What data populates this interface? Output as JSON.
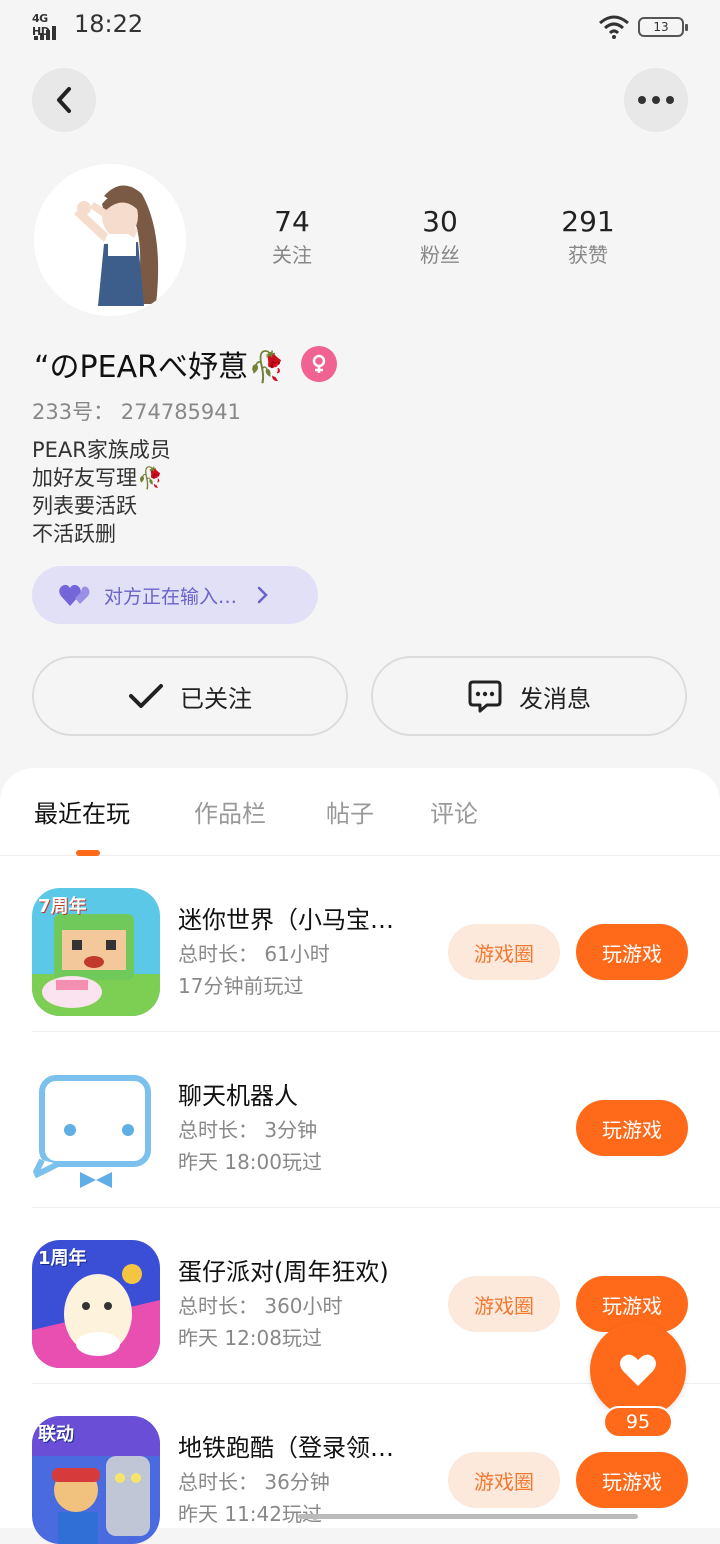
{
  "status_bar": {
    "network": "4G HD",
    "time": "18:22",
    "battery": "13"
  },
  "profile": {
    "stats": [
      {
        "value": "74",
        "label": "关注"
      },
      {
        "value": "30",
        "label": "粉丝"
      },
      {
        "value": "291",
        "label": "获赞"
      }
    ],
    "nickname": "“のPEARべ妤蒠🥀",
    "uid": "233号： 274785941",
    "bio": [
      "PEAR家族成员",
      "加好友写理🥀",
      "列表要活跃",
      "不活跃删"
    ],
    "typing_status": "对方正在输入…"
  },
  "actions": {
    "followed_label": "已关注",
    "message_label": "发消息"
  },
  "tabs": [
    {
      "label": "最近在玩",
      "active": true
    },
    {
      "label": "作品栏",
      "active": false
    },
    {
      "label": "帖子",
      "active": false
    },
    {
      "label": "评论",
      "active": false
    }
  ],
  "games": [
    {
      "name": "迷你世界（小马宝…",
      "duration": "总时长： 61小时",
      "last_played": "17分钟前玩过",
      "circle_label": "游戏圈",
      "play_label": "玩游戏",
      "icon_badge": "7周年"
    },
    {
      "name": "聊天机器人",
      "duration": "总时长： 3分钟",
      "last_played": "昨天 18:00玩过",
      "circle_label": "",
      "play_label": "玩游戏",
      "icon_badge": ""
    },
    {
      "name": "蛋仔派对(周年狂欢)",
      "duration": "总时长： 360小时",
      "last_played": "昨天 12:08玩过",
      "circle_label": "游戏圈",
      "play_label": "玩游戏",
      "icon_badge": "1周年"
    },
    {
      "name": "地铁跑酷（登录领…",
      "duration": "总时长： 36分钟",
      "last_played": "昨天 11:42玩过",
      "circle_label": "游戏圈",
      "play_label": "玩游戏",
      "icon_badge": "联动"
    }
  ],
  "like_fab": {
    "count": "95"
  },
  "colors": {
    "accent": "#ff6a1a",
    "circle_bg": "#fde9dc",
    "chip_bg": "#e2e0f6",
    "chip_text": "#6b63c9",
    "gender": "#f06292"
  }
}
